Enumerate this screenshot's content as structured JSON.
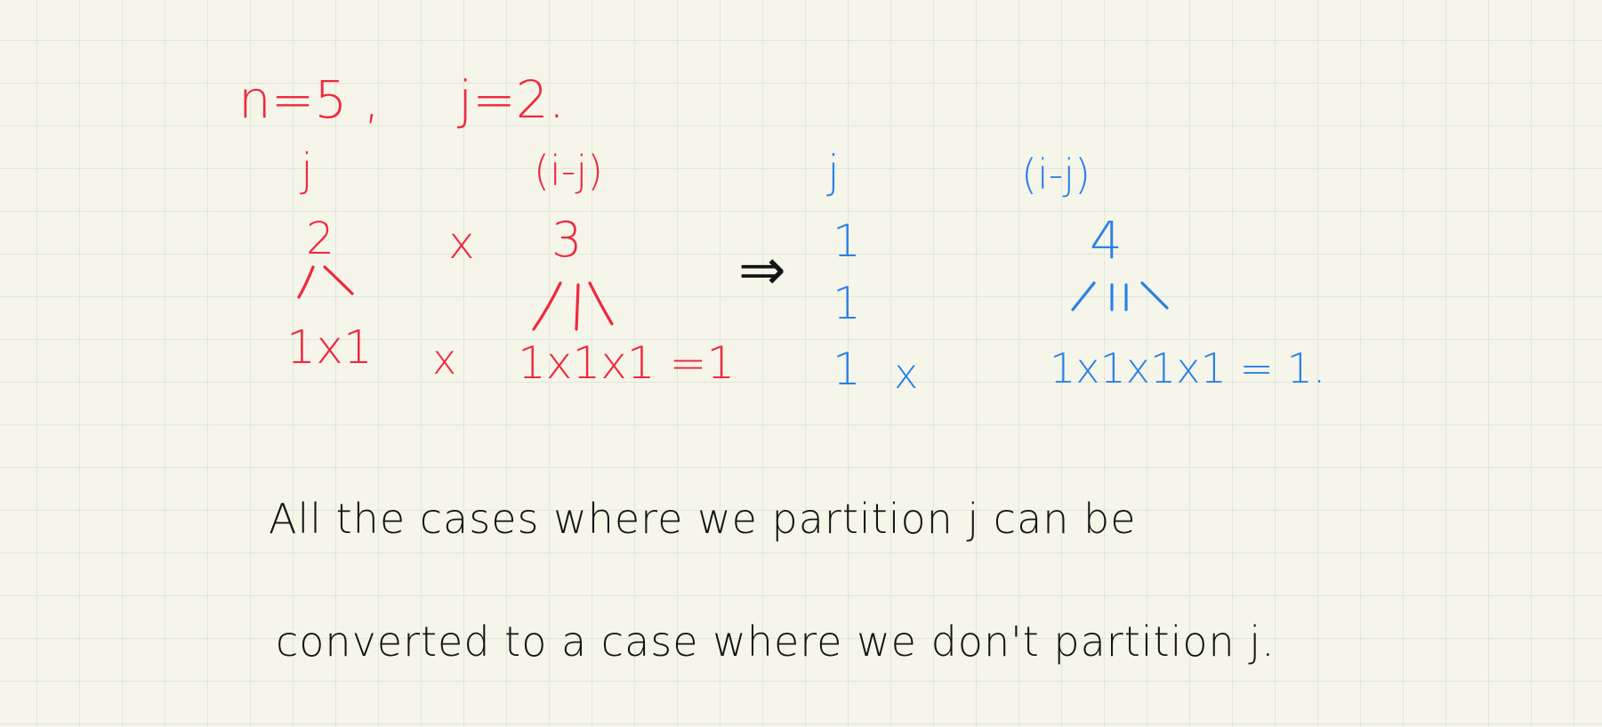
{
  "left_example": {
    "given_n": "n=5 ,",
    "given_j": "j=2.",
    "label_j": "j",
    "label_ij": "(i-j)",
    "j_value": "2",
    "ij_value": "3",
    "times": "x",
    "j_split": "1x1",
    "times2": "x",
    "ij_split": "1x1x1 =1"
  },
  "arrow": "⇒",
  "right_example": {
    "label_j": "j",
    "label_ij": "(i-j)",
    "j_value_1": "1",
    "j_value_2": "1",
    "j_value_3": "1",
    "times": "x",
    "ij_value": "4",
    "ij_split": "1x1x1x1 = 1."
  },
  "note_line1": "All the cases where we partition j can be",
  "note_line2": "converted to a case where we don't partition j.",
  "colors": {
    "left_ink": "#f0283e",
    "right_ink": "#2a82e6",
    "note_ink": "#141414",
    "paper": "#f6f5ea",
    "grid": "#e1e5dc"
  }
}
